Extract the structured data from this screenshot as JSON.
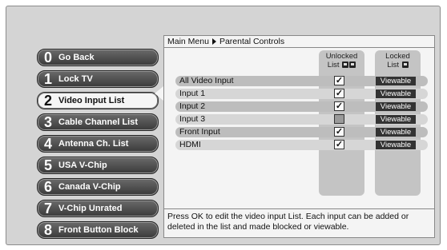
{
  "menu": [
    {
      "num": "0",
      "label": "Go Back"
    },
    {
      "num": "1",
      "label": "Lock TV"
    },
    {
      "num": "2",
      "label": "Video Input List"
    },
    {
      "num": "3",
      "label": "Cable Channel List"
    },
    {
      "num": "4",
      "label": "Antenna Ch. List"
    },
    {
      "num": "5",
      "label": "USA V-Chip"
    },
    {
      "num": "6",
      "label": "Canada V-Chip"
    },
    {
      "num": "7",
      "label": "V-Chip Unrated"
    },
    {
      "num": "8",
      "label": "Front Button Block"
    }
  ],
  "breadcrumb": {
    "root": "Main Menu",
    "current": "Parental Controls"
  },
  "columns": {
    "unlocked_1": "Unlocked",
    "unlocked_2": "List",
    "locked_1": "Locked",
    "locked_2": "List"
  },
  "inputs": [
    {
      "name": "All Video Input",
      "checked": "✓",
      "status": "Viewable"
    },
    {
      "name": "Input 1",
      "checked": "✓",
      "status": "Viewable"
    },
    {
      "name": "Input 2",
      "checked": "✓",
      "status": "Viewable"
    },
    {
      "name": "Input 3",
      "checked": "",
      "status": "Viewable"
    },
    {
      "name": "Front Input",
      "checked": "✓",
      "status": "Viewable"
    },
    {
      "name": "HDMI",
      "checked": "✓",
      "status": "Viewable"
    }
  ],
  "help": "Press OK to edit the video input List. Each input can be added or deleted in the list and made blocked or viewable."
}
